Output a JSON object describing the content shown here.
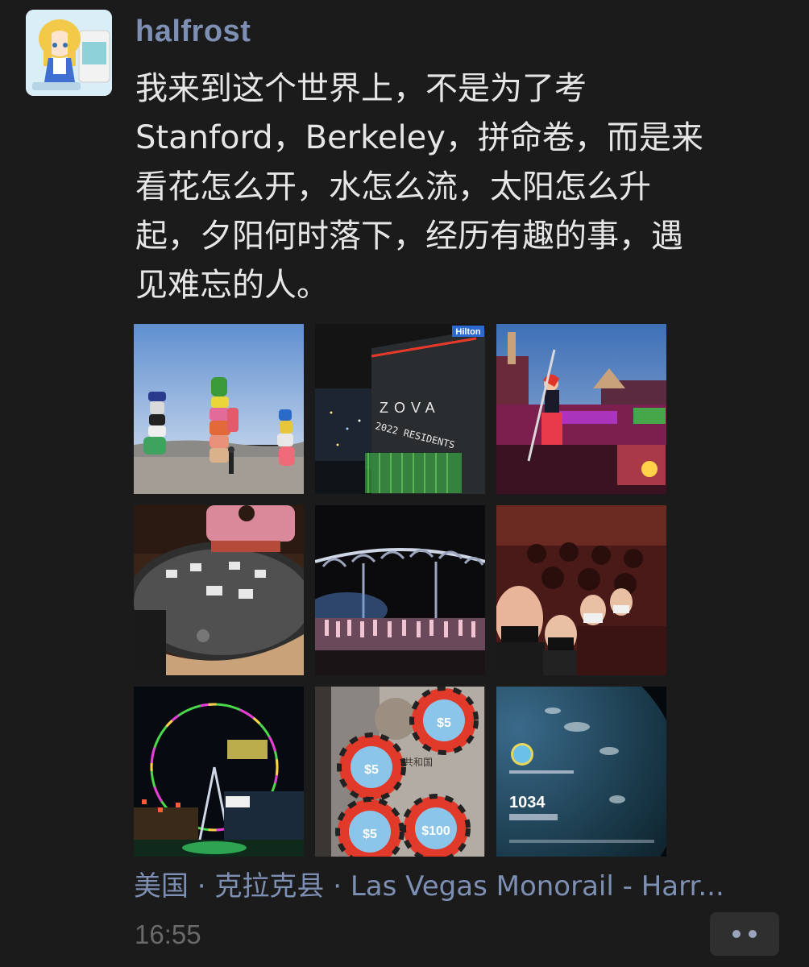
{
  "post": {
    "username": "halfrost",
    "text_lines": [
      "我来到这个世界上，不是为了考",
      "Stanford，Berkeley，拼命卷，而是来",
      "看花怎么开，水怎么流，太阳怎么升",
      "起，夕阳何时落下，经历有趣的事，遇",
      "见难忘的人。"
    ],
    "photos": [
      {
        "subject": "seven-magic-mountains-rock-towers"
      },
      {
        "subject": "night-building-2022-residents-sign"
      },
      {
        "subject": "casino-dancer-statue"
      },
      {
        "subject": "blackjack-table"
      },
      {
        "subject": "stage-show-performers"
      },
      {
        "subject": "theater-selfie-group"
      },
      {
        "subject": "high-roller-ferris-wheel"
      },
      {
        "subject": "casino-chips-passport"
      },
      {
        "subject": "earth-from-space-app"
      }
    ],
    "location": "美国 · 克拉克县 · Las Vegas Monorail - Harr...",
    "time": "16:55"
  },
  "chips": {
    "chip1": "$5",
    "chip2": "$5",
    "chip3": "$5",
    "chip4": "$100"
  },
  "sign_text": "2022 RESIDENTS",
  "app_number": "1034",
  "colors": {
    "background": "#1b1b1b",
    "name_link": "#7d8fb3",
    "text": "#e6e6e6",
    "time": "#6a6a6a"
  }
}
